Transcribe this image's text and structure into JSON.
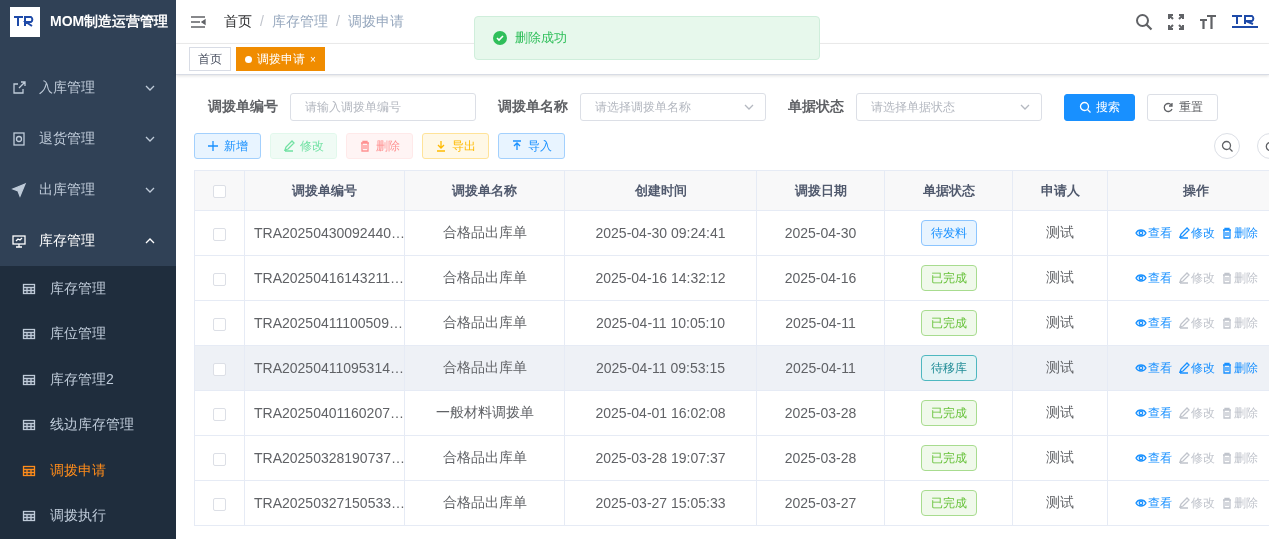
{
  "app": {
    "title": "MOM制造运营管理"
  },
  "sidebar": {
    "items": [
      {
        "label": "入库管理",
        "expanded": false
      },
      {
        "label": "退货管理",
        "expanded": false
      },
      {
        "label": "出库管理",
        "expanded": false
      },
      {
        "label": "库存管理",
        "expanded": true,
        "children": [
          {
            "label": "库存管理",
            "selected": false
          },
          {
            "label": "库位管理",
            "selected": false
          },
          {
            "label": "库存管理2",
            "selected": false
          },
          {
            "label": "线边库存管理",
            "selected": false
          },
          {
            "label": "调拨申请",
            "selected": true
          },
          {
            "label": "调拨执行",
            "selected": false
          }
        ]
      }
    ]
  },
  "breadcrumb": {
    "separator": "/",
    "items": [
      "首页",
      "库存管理",
      "调拨申请"
    ]
  },
  "tags": [
    {
      "label": "首页",
      "selected": false
    },
    {
      "label": "调拨申请",
      "selected": true,
      "close": "×"
    }
  ],
  "toast": {
    "text": "删除成功"
  },
  "filters": [
    {
      "label": "调拨单编号",
      "placeholder": "请输入调拨单编号",
      "kind": "input"
    },
    {
      "label": "调拨单名称",
      "placeholder": "请选择调拨单名称",
      "kind": "select"
    },
    {
      "label": "单据状态",
      "placeholder": "请选择单据状态",
      "kind": "select"
    }
  ],
  "filter_buttons": [
    {
      "label": "搜索",
      "kind": "primary"
    },
    {
      "label": "重置",
      "kind": "default"
    }
  ],
  "toolbar": [
    {
      "label": "新增",
      "kind": "add",
      "disabled": false
    },
    {
      "label": "修改",
      "kind": "edit",
      "disabled": true
    },
    {
      "label": "删除",
      "kind": "delete",
      "disabled": true
    },
    {
      "label": "导出",
      "kind": "export",
      "disabled": false
    },
    {
      "label": "导入",
      "kind": "import",
      "disabled": false
    }
  ],
  "table": {
    "all_checked": false,
    "columns": [
      "调拨单编号",
      "调拨单名称",
      "创建时间",
      "调拨日期",
      "单据状态",
      "申请人",
      "操作"
    ],
    "rows": [
      {
        "checked": false,
        "highlighted": false,
        "cells": [
          "TRA20250430092440…",
          "合格品出库单",
          "2025-04-30 09:24:41",
          "2025-04-30"
        ],
        "status": {
          "text": "待发料",
          "kind": "pending-issue"
        },
        "applicant": "测试",
        "actions": [
          {
            "label": "查看",
            "kind": "view",
            "disabled": false
          },
          {
            "label": "修改",
            "kind": "edit",
            "disabled": false
          },
          {
            "label": "删除",
            "kind": "delete",
            "disabled": false
          }
        ]
      },
      {
        "checked": false,
        "highlighted": false,
        "cells": [
          "TRA20250416143211…",
          "合格品出库单",
          "2025-04-16 14:32:12",
          "2025-04-16"
        ],
        "status": {
          "text": "已完成",
          "kind": "done"
        },
        "applicant": "测试",
        "actions": [
          {
            "label": "查看",
            "kind": "view",
            "disabled": false
          },
          {
            "label": "修改",
            "kind": "edit",
            "disabled": true
          },
          {
            "label": "删除",
            "kind": "delete",
            "disabled": true
          }
        ]
      },
      {
        "checked": false,
        "highlighted": false,
        "cells": [
          "TRA20250411100509…",
          "合格品出库单",
          "2025-04-11 10:05:10",
          "2025-04-11"
        ],
        "status": {
          "text": "已完成",
          "kind": "done"
        },
        "applicant": "测试",
        "actions": [
          {
            "label": "查看",
            "kind": "view",
            "disabled": false
          },
          {
            "label": "修改",
            "kind": "edit",
            "disabled": true
          },
          {
            "label": "删除",
            "kind": "delete",
            "disabled": true
          }
        ]
      },
      {
        "checked": false,
        "highlighted": true,
        "cells": [
          "TRA20250411095314…",
          "合格品出库单",
          "2025-04-11 09:53:15",
          "2025-04-11"
        ],
        "status": {
          "text": "待移库",
          "kind": "pending-move"
        },
        "applicant": "测试",
        "actions": [
          {
            "label": "查看",
            "kind": "view",
            "disabled": false
          },
          {
            "label": "修改",
            "kind": "edit",
            "disabled": false
          },
          {
            "label": "删除",
            "kind": "delete",
            "disabled": false
          }
        ]
      },
      {
        "checked": false,
        "highlighted": false,
        "cells": [
          "TRA20250401160207…",
          "一般材料调拨单",
          "2025-04-01 16:02:08",
          "2025-03-28"
        ],
        "status": {
          "text": "已完成",
          "kind": "done"
        },
        "applicant": "测试",
        "actions": [
          {
            "label": "查看",
            "kind": "view",
            "disabled": false
          },
          {
            "label": "修改",
            "kind": "edit",
            "disabled": true
          },
          {
            "label": "删除",
            "kind": "delete",
            "disabled": true
          }
        ]
      },
      {
        "checked": false,
        "highlighted": false,
        "cells": [
          "TRA20250328190737…",
          "合格品出库单",
          "2025-03-28 19:07:37",
          "2025-03-28"
        ],
        "status": {
          "text": "已完成",
          "kind": "done"
        },
        "applicant": "测试",
        "actions": [
          {
            "label": "查看",
            "kind": "view",
            "disabled": false
          },
          {
            "label": "修改",
            "kind": "edit",
            "disabled": true
          },
          {
            "label": "删除",
            "kind": "delete",
            "disabled": true
          }
        ]
      },
      {
        "checked": false,
        "highlighted": false,
        "cells": [
          "TRA20250327150533…",
          "合格品出库单",
          "2025-03-27 15:05:33",
          "2025-03-27"
        ],
        "status": {
          "text": "已完成",
          "kind": "done"
        },
        "applicant": "测试",
        "actions": [
          {
            "label": "查看",
            "kind": "view",
            "disabled": false
          },
          {
            "label": "修改",
            "kind": "edit",
            "disabled": true
          },
          {
            "label": "删除",
            "kind": "delete",
            "disabled": true
          }
        ]
      }
    ]
  }
}
